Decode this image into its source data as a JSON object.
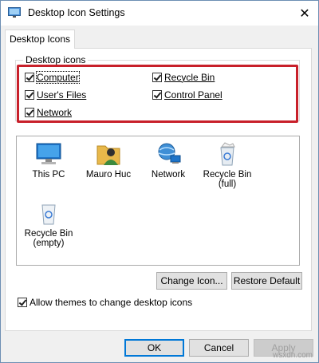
{
  "window": {
    "title": "Desktop Icon Settings"
  },
  "tab": {
    "label": "Desktop Icons"
  },
  "desktop_icons_group": {
    "label": "Desktop icons",
    "items": [
      {
        "label": "Computer",
        "checked": true
      },
      {
        "label": "Recycle Bin",
        "checked": true
      },
      {
        "label": "User's Files",
        "checked": true
      },
      {
        "label": "Control Panel",
        "checked": true
      },
      {
        "label": "Network",
        "checked": true
      }
    ]
  },
  "icons": [
    {
      "label": "This PC",
      "icon": "this-pc-icon"
    },
    {
      "label": "Mauro Huc",
      "icon": "user-folder-icon"
    },
    {
      "label": "Network",
      "icon": "network-icon"
    },
    {
      "label": "Recycle Bin (full)",
      "icon": "recycle-bin-full-icon"
    },
    {
      "label": "Recycle Bin (empty)",
      "icon": "recycle-bin-empty-icon"
    }
  ],
  "buttons": {
    "change_icon": "Change Icon...",
    "restore_default": "Restore Default",
    "ok": "OK",
    "cancel": "Cancel",
    "apply": "Apply"
  },
  "allow_themes": {
    "label": "Allow themes to change desktop icons",
    "checked": true
  },
  "watermark": "wsxdn.com",
  "colors": {
    "highlight": "#c8202a",
    "accent": "#0078d7"
  }
}
